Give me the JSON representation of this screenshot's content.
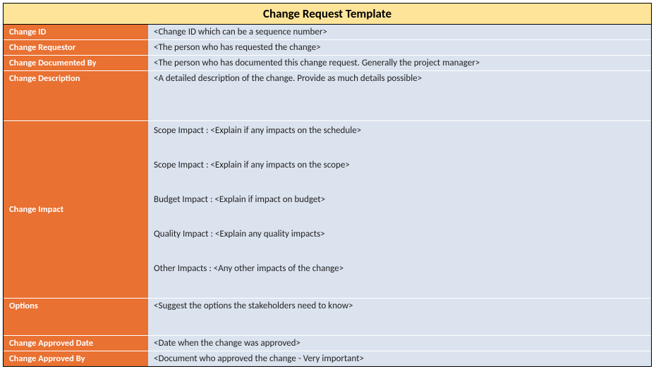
{
  "title": "Change Request Template",
  "rows": {
    "change_id": {
      "label": "Change ID",
      "value": "<Change ID which can be a sequence number>"
    },
    "change_requestor": {
      "label": "Change Requestor",
      "value": "<The person who has requested the change>"
    },
    "change_documented_by": {
      "label": "Change Documented By",
      "value": "<The person who has documented this change request. Generally the project manager>"
    },
    "change_description": {
      "label": "Change Description",
      "value": "<A detailed description of the change. Provide as much details possible>"
    },
    "change_impact": {
      "label": "Change Impact",
      "items": [
        "Scope Impact   :  <Explain if any impacts on the schedule>",
        "Scope Impact   :  <Explain if any impacts on the scope>",
        "Budget Impact  :  <Explain if impact on budget>",
        "Quality Impact  :  <Explain any quality impacts>",
        "Other Impacts   :  <Any other impacts of the change>"
      ]
    },
    "options": {
      "label": "Options",
      "value": "<Suggest the options the stakeholders need to know>"
    },
    "change_approved_date": {
      "label": "Change Approved Date",
      "value": "<Date when the change was approved>"
    },
    "change_approved_by": {
      "label": "Change Approved By",
      "value": "<Document who approved the change - Very important>"
    }
  }
}
